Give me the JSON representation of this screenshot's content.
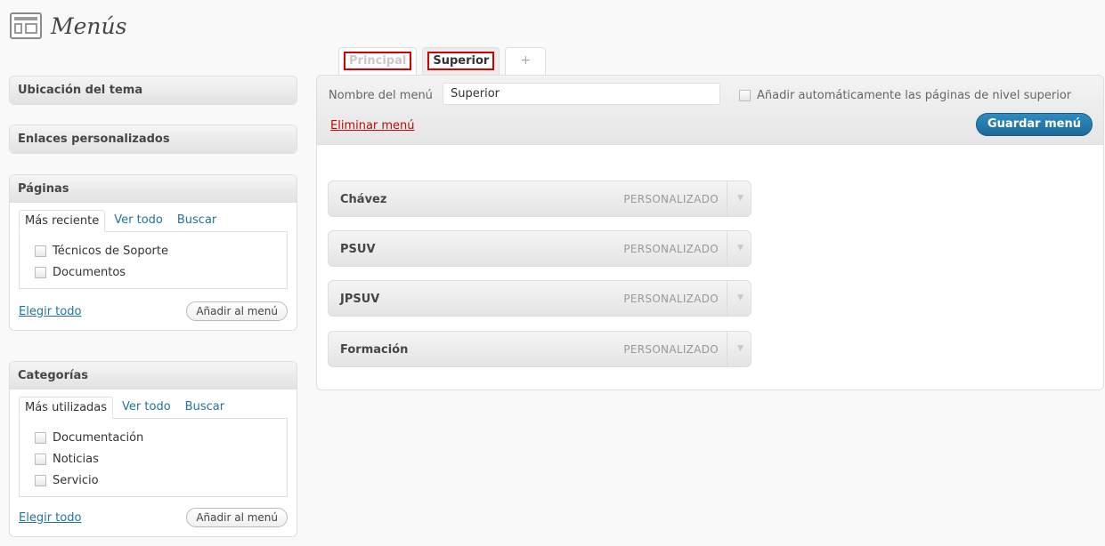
{
  "header": {
    "title": "Menús",
    "icon": "menus-icon"
  },
  "sidebar": {
    "theme_location": {
      "title": "Ubicación del tema"
    },
    "custom_links": {
      "title": "Enlaces personalizados"
    },
    "pages": {
      "title": "Páginas",
      "tabs": [
        "Más reciente",
        "Ver todo",
        "Buscar"
      ],
      "items": [
        "Técnicos de Soporte",
        "Documentos"
      ],
      "select_all": "Elegir todo",
      "add_button": "Añadir al menú"
    },
    "categories": {
      "title": "Categorías",
      "tabs": [
        "Más utilizadas",
        "Ver todo",
        "Buscar"
      ],
      "items": [
        "Documentación",
        "Noticias",
        "Servicio"
      ],
      "select_all": "Elegir todo",
      "add_button": "Añadir al menú"
    }
  },
  "menu_tabs": [
    {
      "label": "Principal",
      "active": false
    },
    {
      "label": "Superior",
      "active": true
    },
    {
      "label": "+",
      "active": false
    }
  ],
  "editor": {
    "name_label": "Nombre del menú",
    "name_value": "Superior",
    "auto_add_label": "Añadir automáticamente las páginas de nivel superior",
    "delete_label": "Eliminar menú",
    "save_label": "Guardar menú"
  },
  "menu_items": [
    {
      "title": "Chávez",
      "type": "PERSONALIZADO"
    },
    {
      "title": "PSUV",
      "type": "PERSONALIZADO"
    },
    {
      "title": "JPSUV",
      "type": "PERSONALIZADO"
    },
    {
      "title": "Formación",
      "type": "PERSONALIZADO"
    }
  ],
  "colors": {
    "accent": "#21759b",
    "danger": "#bc0b0b",
    "highlight_border": "#d40000",
    "save_button": "#2e8bc0"
  }
}
